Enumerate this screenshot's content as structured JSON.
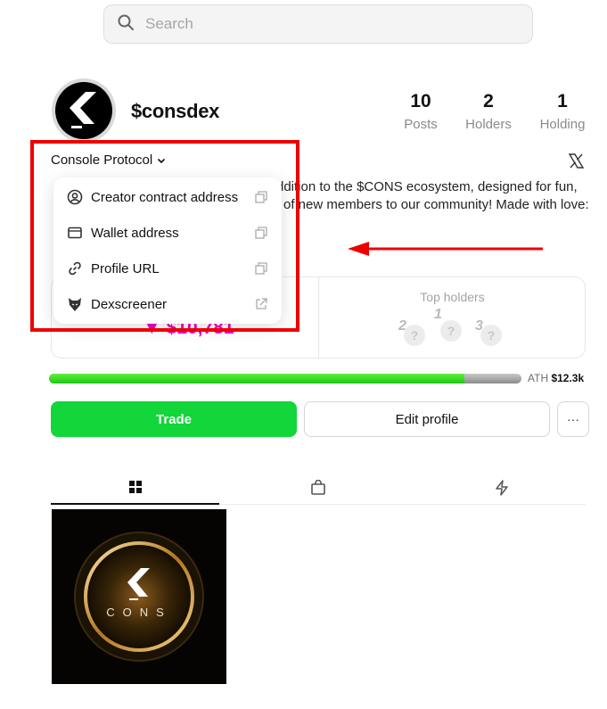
{
  "search": {
    "placeholder": "Search"
  },
  "profile": {
    "username": "$consdex",
    "stats": [
      {
        "value": "10",
        "label": "Posts"
      },
      {
        "value": "2",
        "label": "Holders"
      },
      {
        "value": "1",
        "label": "Holding"
      }
    ],
    "bio_lines": [
      "ddition to the $CONS ecosystem, designed for fun,",
      "of new members to our community! Made with love:"
    ]
  },
  "dropdown": {
    "label": "Console Protocol",
    "items": [
      {
        "label": "Creator contract address",
        "icon": "user-circle-icon",
        "action_icon": "copy-icon"
      },
      {
        "label": "Wallet address",
        "icon": "wallet-icon",
        "action_icon": "copy-icon"
      },
      {
        "label": "Profile URL",
        "icon": "link-icon",
        "action_icon": "copy-icon"
      },
      {
        "label": "Dexscreener",
        "icon": "dexscreener-icon",
        "action_icon": "external-link-icon"
      }
    ]
  },
  "market": {
    "market_cap": "▼ $10,781"
  },
  "holders": {
    "title": "Top holders",
    "ranks": [
      "2",
      "1",
      "3"
    ],
    "placeholder": "?"
  },
  "progress": {
    "fill_fraction": 0.88,
    "ath_label": "ATH",
    "ath_value": "$12.3k"
  },
  "actions": {
    "trade": "Trade",
    "edit_profile": "Edit profile",
    "more": "···"
  },
  "post": {
    "logo_text": "CONS"
  },
  "colors": {
    "trade_green": "#12d63a",
    "highlight_red": "#ee0000",
    "market_pink": "#ee00c8"
  }
}
